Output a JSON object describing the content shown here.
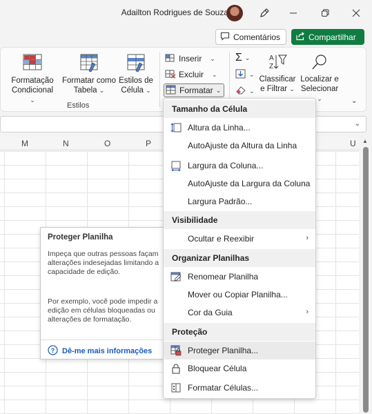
{
  "titlebar": {
    "user_name": "Adailton Rodrigues de Souza",
    "icons": [
      "avatar",
      "pen-icon",
      "minimize-icon",
      "restore-icon",
      "close-icon"
    ]
  },
  "share": {
    "comments_label": "Comentários",
    "share_label": "Compartilhar",
    "share_color": "#107c41"
  },
  "ribbon": {
    "cond_format": [
      "Formatação",
      "Condicional"
    ],
    "format_table": [
      "Formatar como",
      "Tabela"
    ],
    "cell_styles": [
      "Estilos de",
      "Célula"
    ],
    "group_label": "Estilos",
    "insert": "Inserir",
    "delete": "Excluir",
    "format": "Formatar",
    "sort": [
      "Classificar",
      "e Filtrar"
    ],
    "find": [
      "Localizar e",
      "Selecionar"
    ]
  },
  "columns": [
    "M",
    "N",
    "O",
    "P",
    "U"
  ],
  "menu": {
    "sections": {
      "cell_size": "Tamanho da Célula",
      "visibility": "Visibilidade",
      "organize": "Organizar Planilhas",
      "protection": "Proteção"
    },
    "items": {
      "row_height": "Altura da Linha...",
      "autofit_row": "AutoAjuste da Altura da Linha",
      "col_width": "Largura da Coluna...",
      "autofit_col": "AutoAjuste da Largura da Coluna",
      "default_width": "Largura Padrão...",
      "hide_unhide": "Ocultar e Reexibir",
      "rename": "Renomear Planilha",
      "move_copy": "Mover ou Copiar Planilha...",
      "tab_color": "Cor da Guia",
      "protect": "Proteger Planilha...",
      "lock": "Bloquear Célula",
      "format_cells": "Formatar Células..."
    }
  },
  "tooltip": {
    "title": "Proteger Planilha",
    "para1": "Impeça que outras pessoas façam alterações indesejadas limitando a capacidade de edição.",
    "para2": "Por exemplo, você pode impedir a edição em células bloqueadas ou alterações de formatação.",
    "link": "Dê-me mais informações"
  }
}
